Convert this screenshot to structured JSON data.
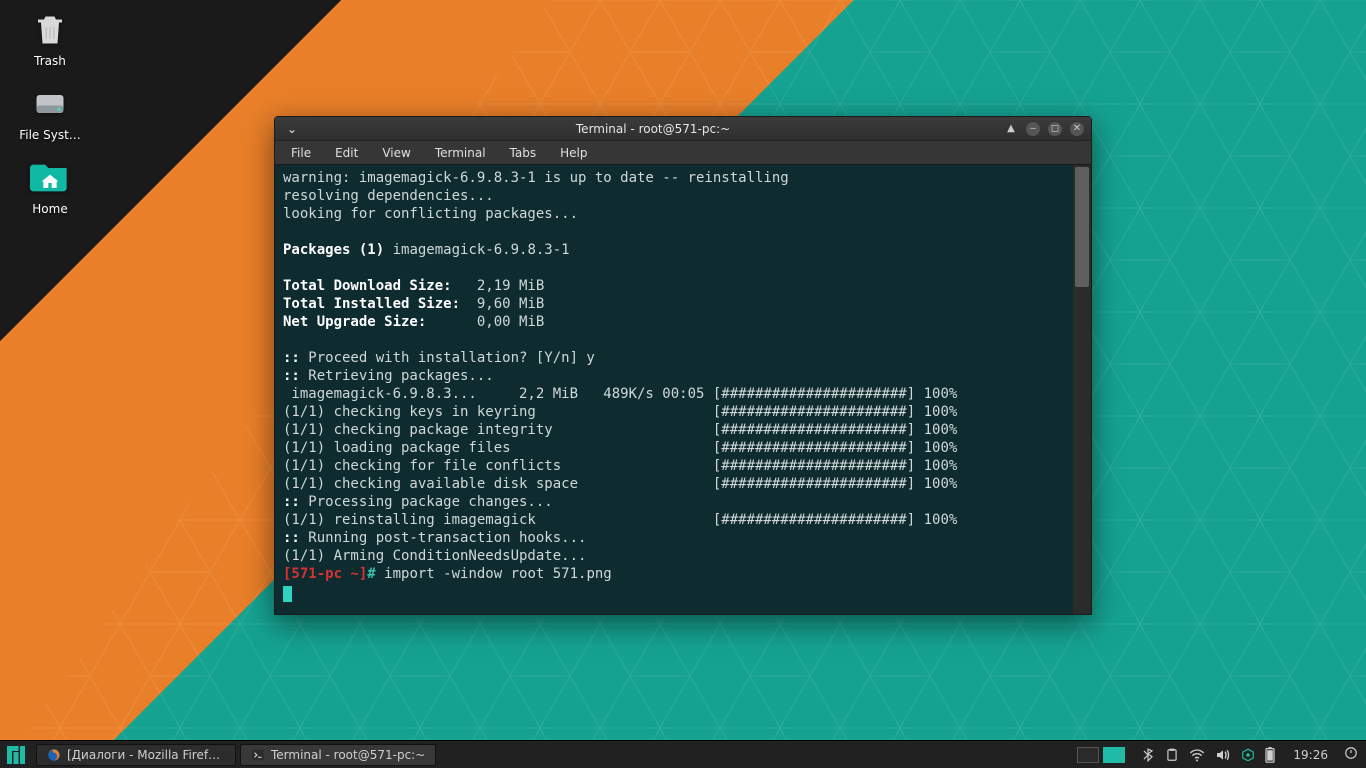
{
  "desktop": {
    "icons": [
      {
        "name": "trash",
        "label": "Trash"
      },
      {
        "name": "filesystem",
        "label": "File Syst…"
      },
      {
        "name": "home",
        "label": "Home"
      }
    ]
  },
  "window": {
    "title": "Terminal - root@571-pc:~",
    "menus": [
      "File",
      "Edit",
      "View",
      "Terminal",
      "Tabs",
      "Help"
    ],
    "lines": [
      "warning: imagemagick-6.9.8.3-1 is up to date -- reinstalling",
      "resolving dependencies...",
      "looking for conflicting packages...",
      "",
      "Packages (1) imagemagick-6.9.8.3-1",
      "",
      "Total Download Size:   2,19 MiB",
      "Total Installed Size:  9,60 MiB",
      "Net Upgrade Size:      0,00 MiB",
      "",
      ":: Proceed with installation? [Y/n] y",
      ":: Retrieving packages...",
      " imagemagick-6.9.8.3...     2,2 MiB   489K/s 00:05 [######################] 100%",
      "(1/1) checking keys in keyring                     [######################] 100%",
      "(1/1) checking package integrity                   [######################] 100%",
      "(1/1) loading package files                        [######################] 100%",
      "(1/1) checking for file conflicts                  [######################] 100%",
      "(1/1) checking available disk space                [######################] 100%",
      ":: Processing package changes...",
      "(1/1) reinstalling imagemagick                     [######################] 100%",
      ":: Running post-transaction hooks...",
      "(1/1) Arming ConditionNeedsUpdate..."
    ],
    "bold_prefixes": [
      "::",
      "Packages (1)",
      "Total Download Size:",
      "Total Installed Size:",
      "Net Upgrade Size:"
    ],
    "prompt": {
      "host": "[571-pc ~]",
      "sep": "#",
      "cmd": "import -window root 571.png"
    }
  },
  "taskbar": {
    "tasks": [
      {
        "icon": "firefox",
        "label": "[Диалоги - Mozilla Firefox]",
        "active": false
      },
      {
        "icon": "terminal",
        "label": "Terminal - root@571-pc:~",
        "active": true
      }
    ],
    "clock": "19:26"
  },
  "colors": {
    "accent": "#1fbba6",
    "orange": "#e97f29",
    "dark": "#1a1a1a"
  }
}
